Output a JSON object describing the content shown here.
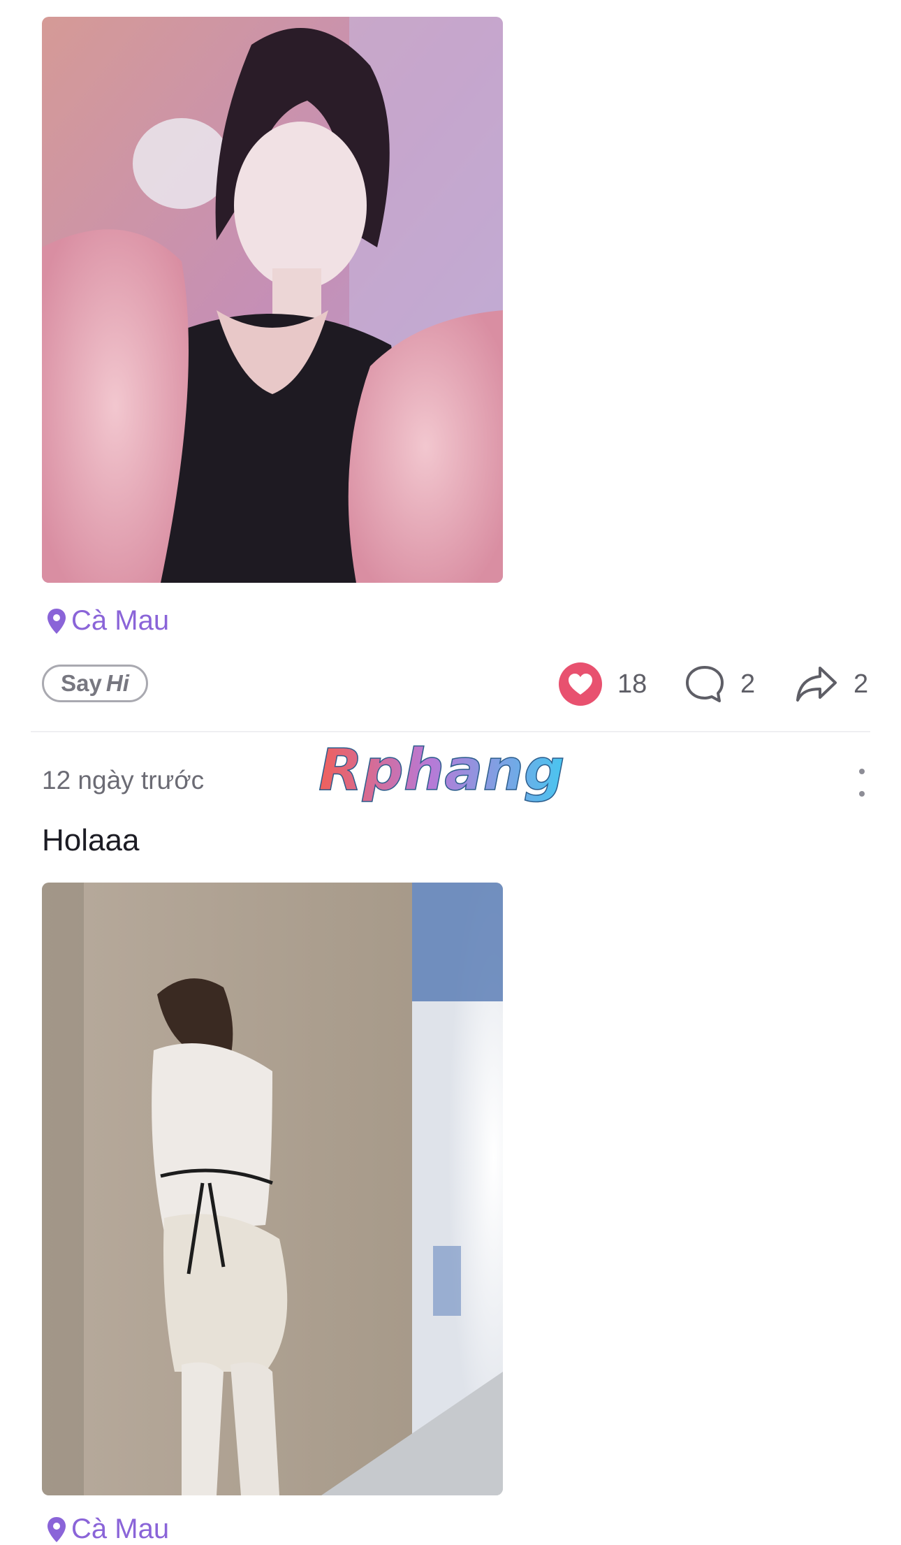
{
  "post_1": {
    "location": "Cà Mau",
    "say_hi": {
      "say": "Say",
      "hi": "Hi"
    },
    "likes": "18",
    "comments": "2",
    "shares": "2"
  },
  "post_2": {
    "time_ago": "12 ngày trước",
    "text": "Holaaa",
    "location": "Cà Mau"
  },
  "watermark": "Rphang",
  "colors": {
    "accent_purple": "#8a64d8",
    "like_red": "#e8516f",
    "icon_gray": "#5e5e66"
  }
}
